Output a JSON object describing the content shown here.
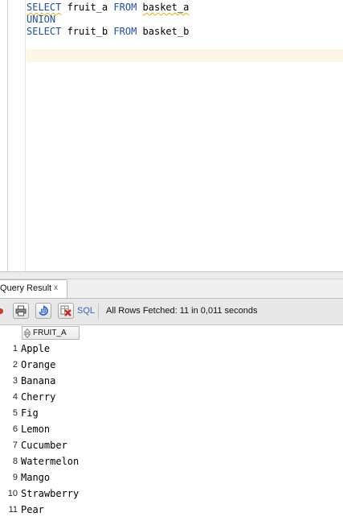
{
  "editor": {
    "lines": [
      {
        "keyword": "SELECT",
        "text": " fruit_a ",
        "keyword2": "FROM",
        "table": "basket_a"
      },
      {
        "keyword": "UNION"
      },
      {
        "keyword": "SELECT",
        "text": " fruit_b ",
        "keyword2": "FROM",
        "table": "basket_b"
      }
    ]
  },
  "result_panel": {
    "tab_label": "Query Result",
    "tab_close": "x",
    "sql_label": "SQL",
    "status": "All Rows Fetched: 11 in 0,011 seconds"
  },
  "grid": {
    "column_header": "FRUIT_A",
    "rows": [
      {
        "num": "1",
        "value": "Apple"
      },
      {
        "num": "2",
        "value": "Orange"
      },
      {
        "num": "3",
        "value": "Banana"
      },
      {
        "num": "4",
        "value": "Cherry"
      },
      {
        "num": "5",
        "value": "Fig"
      },
      {
        "num": "6",
        "value": "Lemon"
      },
      {
        "num": "7",
        "value": "Cucumber"
      },
      {
        "num": "8",
        "value": "Watermelon"
      },
      {
        "num": "9",
        "value": "Mango"
      },
      {
        "num": "10",
        "value": "Strawberry"
      },
      {
        "num": "11",
        "value": "Pear"
      }
    ]
  },
  "colors": {
    "keyword": "#1f4fa8",
    "current_line": "#fdf6e3",
    "sql_link": "#2a62c9",
    "pin": "#d23b2a"
  },
  "icons": [
    "pin-icon",
    "print-icon",
    "refresh-icon",
    "delete-icon",
    "sort-icon"
  ]
}
